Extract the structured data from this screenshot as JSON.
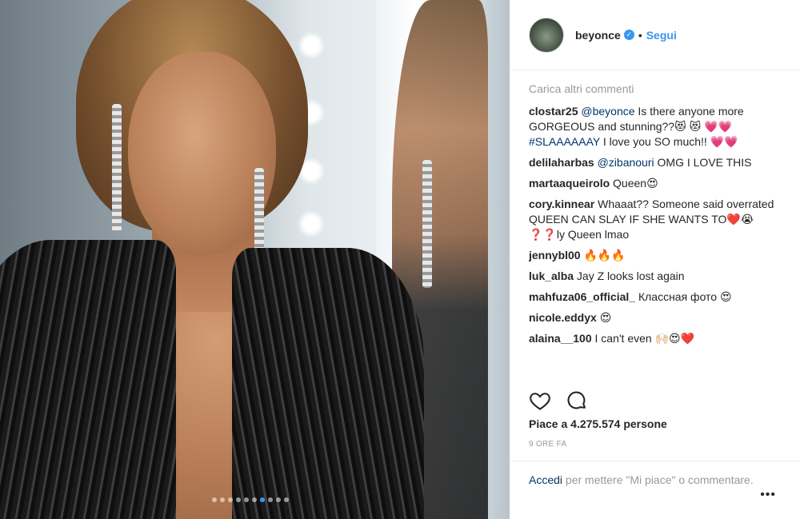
{
  "post": {
    "image_alt": "Photo",
    "carousel": {
      "count": 10,
      "active_index": 6
    }
  },
  "header": {
    "username": "beyonce",
    "verified_icon": "verified-badge-icon",
    "separator": "•",
    "follow_label": "Segui"
  },
  "comments": {
    "load_more": "Carica altri commenti",
    "items": [
      {
        "user": "clostar25",
        "mention": "@beyonce",
        "text1": " Is there anyone more GORGEOUS and stunning??😻 😻 💗💗 ",
        "hashtag": "#SLAAAAAAY",
        "text2": " I love you SO much!! 💗💗"
      },
      {
        "user": "delilaharbas",
        "mention": "@zibanouri",
        "text1": " OMG I LOVE THIS"
      },
      {
        "user": "martaaqueirolo",
        "text1": " Queen😍"
      },
      {
        "user": "cory.kinnear",
        "text1": " Whaaat?? Someone said overrated QUEEN CAN SLAY IF SHE WANTS TO❤️😭 ❓❓ly Queen lmao"
      },
      {
        "user": "jennybl00",
        "text1": " 🔥🔥🔥"
      },
      {
        "user": "luk_alba",
        "text1": " Jay Z looks lost again"
      },
      {
        "user": "mahfuza06_official_",
        "text1": " Классная фото 😍"
      },
      {
        "user": "nicole.eddyx",
        "text1": " 😍"
      },
      {
        "user": "alaina__100",
        "text1": " I can't even 🙌🏻😍❤️"
      }
    ]
  },
  "actions": {
    "like_icon": "heart-icon",
    "comment_icon": "comment-icon"
  },
  "likes_text": "Piace a 4.275.574 persone",
  "timestamp": "9 ORE FA",
  "login": {
    "link": "Accedi",
    "rest": " per mettere \"Mi piace\" o commentare."
  },
  "more_label": "•••"
}
